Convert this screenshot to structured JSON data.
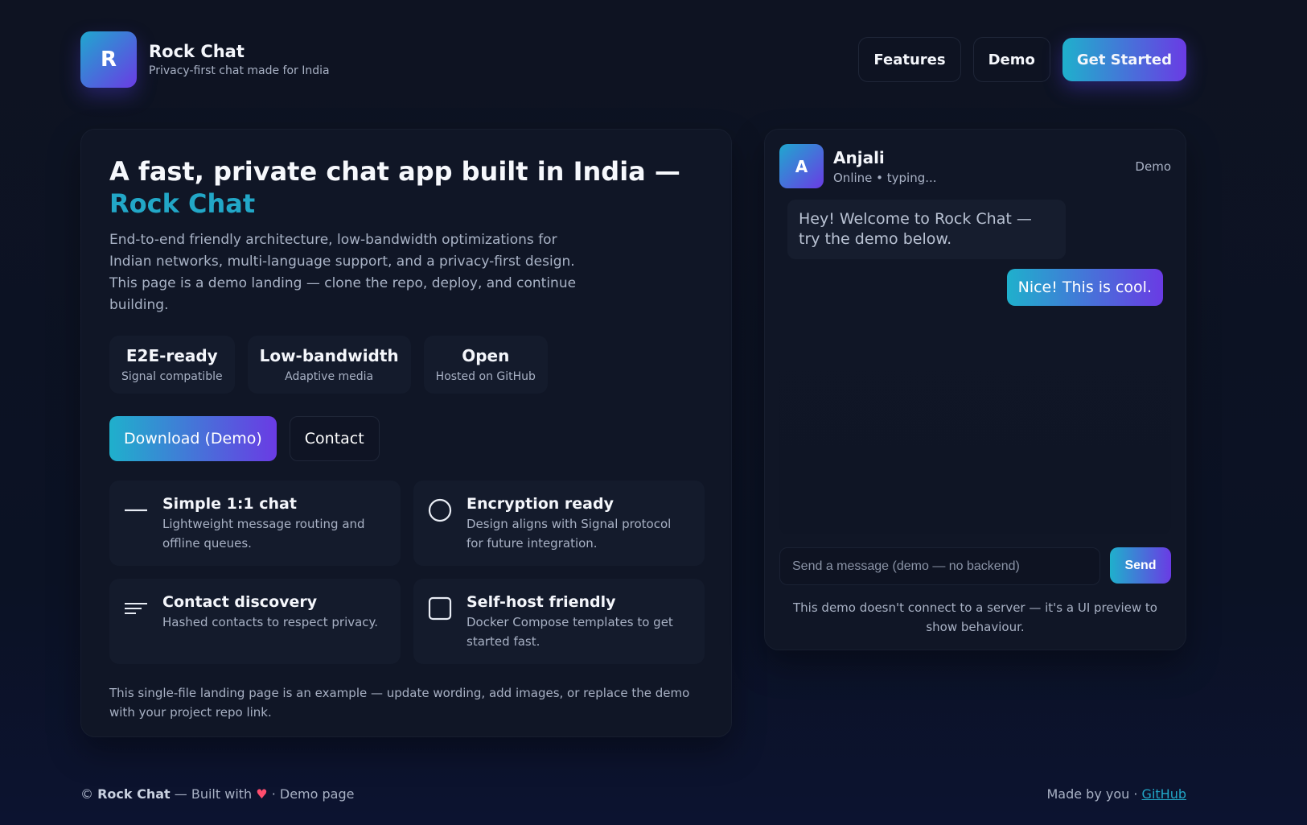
{
  "brand": {
    "logo_letter": "R",
    "title": "Rock Chat",
    "subtitle": "Privacy-first chat made for India"
  },
  "nav": {
    "features": "Features",
    "demo": "Demo",
    "get_started": "Get Started"
  },
  "hero": {
    "title_main": "A fast, private chat app built in India — ",
    "title_accent": "Rock Chat",
    "description": "End-to-end friendly architecture, low-bandwidth optimizations for Indian networks, multi-language support, and a privacy-first design. This page is a demo landing — clone the repo, deploy, and continue building.",
    "stats": [
      {
        "title": "E2E-ready",
        "sub": "Signal compatible"
      },
      {
        "title": "Low-bandwidth",
        "sub": "Adaptive media"
      },
      {
        "title": "Open",
        "sub": "Hosted on GitHub"
      }
    ],
    "download_label": "Download (Demo)",
    "contact_label": "Contact",
    "features": [
      {
        "title": "Simple 1:1 chat",
        "desc": "Lightweight message routing and offline queues.",
        "icon": "dash-icon"
      },
      {
        "title": "Encryption ready",
        "desc": "Design aligns with Signal protocol for future integration.",
        "icon": "circle-icon"
      },
      {
        "title": "Contact discovery",
        "desc": "Hashed contacts to respect privacy.",
        "icon": "lines-icon"
      },
      {
        "title": "Self-host friendly",
        "desc": "Docker Compose templates to get started fast.",
        "icon": "square-icon"
      }
    ],
    "note": "This single-file landing page is an example — update wording, add images, or replace the demo with your project repo link."
  },
  "chat": {
    "avatar_letter": "A",
    "name": "Anjali",
    "status": "Online • typing...",
    "badge": "Demo",
    "messages": {
      "incoming": "Hey! Welcome to Rock Chat — try the demo below.",
      "outgoing": "Nice! This is cool."
    },
    "input_placeholder": "Send a message (demo — no backend)",
    "send_label": "Send",
    "note": "This demo doesn't connect to a server — it's a UI preview to show behaviour."
  },
  "footer": {
    "copyright": "©",
    "brand": "Rock Chat",
    "built_with": "— Built with",
    "heart": "♥",
    "demo_page": "· Demo page",
    "made_by": "Made by you ·",
    "github": "GitHub"
  },
  "colors": {
    "accent": "#22a7c7",
    "gradient_start": "#1fb0cc",
    "gradient_end": "#6a3be4",
    "background": "#0e1322",
    "card": "#101626"
  }
}
